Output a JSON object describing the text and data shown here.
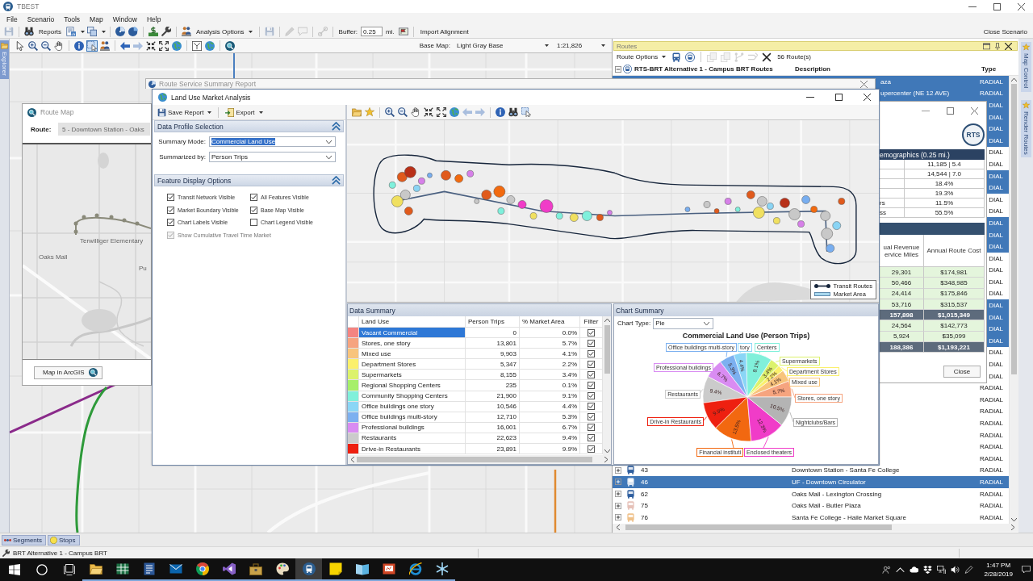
{
  "window": {
    "title": "TBEST"
  },
  "menu": [
    {
      "label": "File"
    },
    {
      "label": "Scenario"
    },
    {
      "label": "Tools"
    },
    {
      "label": "Map"
    },
    {
      "label": "Window"
    },
    {
      "label": "Help"
    }
  ],
  "toolbar": {
    "items": [
      {
        "kind": "icon",
        "disabled": true
      },
      {
        "kind": "separator"
      },
      {
        "kind": "icon",
        "disabled": false
      },
      {
        "kind": "button",
        "label": "Reports"
      },
      {
        "kind": "icon-menu",
        "disabled": false
      },
      {
        "kind": "icon-menu",
        "disabled": false
      },
      {
        "kind": "separator"
      },
      {
        "kind": "icon",
        "disabled": false
      },
      {
        "kind": "icon",
        "disabled": false
      },
      {
        "kind": "separator"
      },
      {
        "kind": "icon",
        "disabled": false
      },
      {
        "kind": "icon",
        "disabled": false
      },
      {
        "kind": "separator"
      },
      {
        "kind": "icon",
        "disabled": false
      },
      {
        "kind": "menu",
        "label": "Analysis Options"
      },
      {
        "kind": "separator"
      },
      {
        "kind": "icon",
        "disabled": true
      },
      {
        "kind": "separator"
      },
      {
        "kind": "icon",
        "disabled": true
      },
      {
        "kind": "icon",
        "disabled": true
      },
      {
        "kind": "separator"
      },
      {
        "kind": "icon",
        "disabled": true
      },
      {
        "kind": "separator"
      },
      {
        "kind": "field",
        "label": "Buffer:",
        "value": "0.25",
        "unit": "mi."
      },
      {
        "kind": "icon",
        "disabled": false
      },
      {
        "kind": "separator"
      },
      {
        "kind": "button",
        "label": "Import Alignment"
      }
    ],
    "close_label": "Close Scenario"
  },
  "explorer_tab": {
    "label": "Explorer"
  },
  "map_view": {
    "tools": [
      {
        "kind": "tool",
        "selected": false,
        "disabled": false
      },
      {
        "kind": "tool",
        "selected": false,
        "disabled": false
      },
      {
        "kind": "tool",
        "selected": false,
        "disabled": false
      },
      {
        "kind": "tool",
        "selected": false,
        "disabled": false
      },
      {
        "kind": "separator"
      },
      {
        "kind": "tool",
        "selected": false,
        "disabled": false
      },
      {
        "kind": "tool",
        "selected": true,
        "disabled": false
      },
      {
        "kind": "tool",
        "selected": false,
        "disabled": false
      },
      {
        "kind": "separator"
      },
      {
        "kind": "tool",
        "selected": false,
        "disabled": false
      },
      {
        "kind": "tool",
        "selected": false,
        "disabled": true
      },
      {
        "kind": "tool",
        "selected": false,
        "disabled": false
      },
      {
        "kind": "tool",
        "selected": false,
        "disabled": false
      },
      {
        "kind": "tool",
        "selected": false,
        "disabled": false
      },
      {
        "kind": "separator"
      },
      {
        "kind": "tool",
        "selected": false,
        "disabled": false
      },
      {
        "kind": "tool",
        "selected": false,
        "disabled": false
      },
      {
        "kind": "separator"
      },
      {
        "kind": "tool",
        "selected": false,
        "disabled": false
      }
    ],
    "base_map_label": "Base Map:",
    "base_map": "Light Gray Base",
    "scale": "1:21,826"
  },
  "routes_panel": {
    "title": "Routes",
    "options_label": "Route Options",
    "tools": [
      {
        "kind": "tool",
        "disabled": false
      },
      {
        "kind": "tool",
        "disabled": false
      },
      {
        "kind": "separator"
      },
      {
        "kind": "tool",
        "disabled": true
      },
      {
        "kind": "tool",
        "disabled": true
      },
      {
        "kind": "tool",
        "disabled": true
      },
      {
        "kind": "tool",
        "disabled": true
      },
      {
        "kind": "tool",
        "disabled": false
      }
    ],
    "route_count": "56 Route(s)",
    "group": {
      "label": "RTS-BRT Alternative 1 - Campus BRT Routes",
      "expanded": true
    },
    "columns": [
      "Description",
      "Type"
    ],
    "rows": [
      {
        "description": "aza",
        "type": "RADIAL",
        "selected": true
      },
      {
        "description": "upercenter (NE 12 AVE)",
        "type": "RADIAL",
        "selected": true
      },
      {
        "type": "DIAL",
        "selected": true
      },
      {
        "type": "DIAL",
        "selected": true
      },
      {
        "type": "DIAL",
        "selected": true
      },
      {
        "type": "DIAL",
        "selected": true
      },
      {
        "type": "DIAL",
        "selected": false
      },
      {
        "type": "DIAL",
        "selected": false
      },
      {
        "type": "DIAL",
        "selected": true
      },
      {
        "type": "DIAL",
        "selected": true
      },
      {
        "type": "DIAL",
        "selected": false
      },
      {
        "type": "DIAL",
        "selected": false
      },
      {
        "type": "DIAL",
        "selected": true
      },
      {
        "type": "DIAL",
        "selected": true
      },
      {
        "type": "DIAL",
        "selected": true
      },
      {
        "type": "DIAL",
        "selected": false
      },
      {
        "type": "DIAL",
        "selected": false
      },
      {
        "type": "DIAL",
        "selected": false
      },
      {
        "type": "DIAL",
        "selected": false
      },
      {
        "type": "DIAL",
        "selected": true
      },
      {
        "type": "DIAL",
        "selected": true
      },
      {
        "type": "DIAL",
        "selected": true
      },
      {
        "type": "DIAL",
        "selected": true
      },
      {
        "type": "DIAL",
        "selected": false
      },
      {
        "type": "DIAL",
        "selected": false
      },
      {
        "type": "DIAL",
        "selected": false
      },
      {
        "type": "RADIAL",
        "selected": false
      },
      {
        "type": "RADIAL",
        "selected": false
      },
      {
        "type": "RADIAL",
        "selected": false
      },
      {
        "type": "RADIAL",
        "selected": false
      },
      {
        "type": "RADIAL",
        "selected": false
      },
      {
        "type": "RADIAL",
        "selected": false
      },
      {
        "type": "RADIAL",
        "selected": false
      },
      {
        "expanded": false,
        "color": "#2f5f9f",
        "number": "43",
        "description": "Downtown Station - Santa Fe College",
        "type": "RADIAL",
        "selected": false
      },
      {
        "expanded": false,
        "color": "#dde7f3",
        "number": "46",
        "description": "UF - Downtown Circulator",
        "type": "RADIAL",
        "selected": true
      },
      {
        "expanded": false,
        "color": "#2f5f9f",
        "number": "62",
        "description": "Oaks Mall - Lexington Crossing",
        "type": "RADIAL",
        "selected": false
      },
      {
        "expanded": false,
        "color": "#e6c1b8",
        "number": "75",
        "description": "Oaks Mall - Butler Plaza",
        "type": "RADIAL",
        "selected": false
      },
      {
        "expanded": false,
        "color": "#efc189",
        "number": "76",
        "description": "Santa Fe College - Haile Market Square",
        "type": "RADIAL",
        "selected": false
      }
    ]
  },
  "side_tabs": [
    {
      "label": "Map Control"
    },
    {
      "label": "Render Routes"
    }
  ],
  "route_map_window": {
    "title": "Route Map",
    "route_label": "Route:",
    "route_value": "5 - Downtown Station - Oaks",
    "map_labels": [
      "Oaks Mall",
      "Terwilliger Elementary",
      "Pu"
    ],
    "button": "Map in ArcGIS"
  },
  "summary_report_window": {
    "title": "Route Service Summary Report"
  },
  "report_panel": {
    "logo": "RTS",
    "demographics_title": "emographics (0.25 mi.)",
    "demographics": [
      {
        "value": "11,185 | 5.4"
      },
      {
        "value": "14,544 | 7.0"
      },
      {
        "value": "18.4%"
      },
      {
        "value": "19.3%"
      },
      {
        "label": "rs",
        "value": "11.5%"
      },
      {
        "label": "ss",
        "value": "55.5%"
      }
    ],
    "cost_columns": [
      "ual Revenue\nervice Miles",
      "Annual Route Cost"
    ],
    "cost_rows": [
      {
        "kind": "route",
        "miles": "29,301",
        "cost": "$174,981"
      },
      {
        "kind": "route",
        "miles": "50,466",
        "cost": "$348,985"
      },
      {
        "kind": "route",
        "miles": "24,414",
        "cost": "$175,846"
      },
      {
        "kind": "route",
        "miles": "53,716",
        "cost": "$315,537"
      },
      {
        "kind": "total",
        "miles": "157,898",
        "cost": "$1,015,349"
      },
      {
        "kind": "route",
        "miles": "24,564",
        "cost": "$142,773"
      },
      {
        "kind": "route",
        "miles": "5,924",
        "cost": "$35,099"
      },
      {
        "kind": "total",
        "miles": "188,386",
        "cost": "$1,193,221"
      }
    ],
    "close_label": "Close"
  },
  "land_use_window": {
    "title": "Land Use Market Analysis",
    "toolbar": [
      {
        "label": "Save Report"
      },
      {
        "label": "Export"
      }
    ],
    "data_profile": {
      "title": "Data Profile Selection",
      "expanded": true,
      "fields": [
        {
          "label": "Summary Mode:",
          "value": "Commercial Land Use",
          "selected": true
        },
        {
          "label": "Summarized by:",
          "value": "Person Trips",
          "selected": false
        }
      ]
    },
    "display_options": {
      "title": "Feature Display Options",
      "expanded": true,
      "options": [
        {
          "label": "Transit Network Visible",
          "checked": true
        },
        {
          "label": "All Features Visible",
          "checked": true
        },
        {
          "label": "Market Boundary Visible",
          "checked": true
        },
        {
          "label": "Base Map Visible",
          "checked": true
        },
        {
          "label": "Chart Labels Visible",
          "checked": true
        },
        {
          "label": "Chart Legend Visible",
          "checked": false
        }
      ],
      "cumulative": {
        "label": "Show Cumulative Travel Time Market",
        "checked": true,
        "disabled": true
      }
    },
    "map_tools": [
      {
        "kind": "tool",
        "disabled": false
      },
      {
        "kind": "tool",
        "disabled": false
      },
      {
        "kind": "separator"
      },
      {
        "kind": "tool",
        "disabled": false
      },
      {
        "kind": "tool",
        "disabled": false
      },
      {
        "kind": "tool",
        "disabled": false
      },
      {
        "kind": "tool",
        "disabled": false
      },
      {
        "kind": "tool",
        "disabled": false
      },
      {
        "kind": "tool",
        "disabled": false
      },
      {
        "kind": "tool",
        "disabled": true
      },
      {
        "kind": "tool",
        "disabled": true
      },
      {
        "kind": "separator"
      },
      {
        "kind": "tool",
        "disabled": false
      },
      {
        "kind": "tool",
        "disabled": false
      },
      {
        "kind": "tool",
        "disabled": false
      }
    ],
    "legend": [
      {
        "label": "Transit Routes",
        "kind": "line"
      },
      {
        "label": "Market Area",
        "kind": "area"
      }
    ],
    "data_summary": {
      "title": "Data Summary",
      "columns": [
        "Land Use",
        "Person Trips",
        "% Market Area",
        "Filter"
      ],
      "rows": [
        {
          "color": "#f48481",
          "land_use": "Vacant Commercial",
          "trips": "0",
          "share": "0.0%",
          "filter": true,
          "selected": true
        },
        {
          "color": "#f6a47f",
          "land_use": "Stores, one story",
          "trips": "13,801",
          "share": "5.7%",
          "filter": true,
          "selected": false
        },
        {
          "color": "#f8c47c",
          "land_use": "Mixed use",
          "trips": "9,903",
          "share": "4.1%",
          "filter": true,
          "selected": false
        },
        {
          "color": "#fbf06c",
          "land_use": "Department Stores",
          "trips": "5,347",
          "share": "2.2%",
          "filter": true,
          "selected": false
        },
        {
          "color": "#dcf26c",
          "land_use": "Supermarkets",
          "trips": "8,155",
          "share": "3.4%",
          "filter": true,
          "selected": false
        },
        {
          "color": "#a6ef6a",
          "land_use": "Regional Shopping Centers",
          "trips": "235",
          "share": "0.1%",
          "filter": true,
          "selected": false
        },
        {
          "color": "#80f0da",
          "land_use": "Community Shopping Centers",
          "trips": "21,900",
          "share": "9.1%",
          "filter": true,
          "selected": false
        },
        {
          "color": "#8ad6f6",
          "land_use": "Office buildings one story",
          "trips": "10,546",
          "share": "4.4%",
          "filter": true,
          "selected": false
        },
        {
          "color": "#7cb0f0",
          "land_use": "Office buildings multi-story",
          "trips": "12,710",
          "share": "5.3%",
          "filter": true,
          "selected": false
        },
        {
          "color": "#d98cf2",
          "land_use": "Professional buildings",
          "trips": "16,001",
          "share": "6.7%",
          "filter": true,
          "selected": false
        },
        {
          "color": "#cbcbcb",
          "land_use": "Restaurants",
          "trips": "22,623",
          "share": "9.4%",
          "filter": true,
          "selected": false
        },
        {
          "color": "#ee2010",
          "land_use": "Drive-in Restaurants",
          "trips": "23,891",
          "share": "9.9%",
          "filter": true,
          "selected": false
        }
      ]
    },
    "chart_summary": {
      "title": "Chart Summary",
      "chart_type_label": "Chart Type:",
      "chart_type": "Pie",
      "chart_data": {
        "type": "pie",
        "title": "Commercial Land Use (Person Trips)",
        "categories": [
          "Stores, one story",
          "Mixed use",
          "Department Stores",
          "Supermarkets",
          "Centers",
          "tory",
          "Office buildings multi-story",
          "Professional buildings",
          "Restaurants",
          "Drive-in Restaurants",
          "Financial instituti",
          "Enclosed theaters",
          "Nightclubs/Bars"
        ],
        "values": [
          5.7,
          4.1,
          2.2,
          3.4,
          9.1,
          4.4,
          5.3,
          6.7,
          9.4,
          9.9,
          13.5,
          12.3,
          10.5
        ],
        "value_labels": [
          "5.7%",
          "4.1%",
          "2.2%",
          "3.4%",
          "9.1%",
          "4.4%",
          "5.3%",
          "6.7%",
          "9.4%",
          "9.9%",
          "13.5%",
          "12.3%",
          "10.5%"
        ],
        "colors": [
          "#f6a47f",
          "#f8c47c",
          "#fbf06c",
          "#dcf26c",
          "#80f0da",
          "#8ad6f6",
          "#7cb0f0",
          "#d98cf2",
          "#cbcbcb",
          "#ee2010",
          "#f26810",
          "#f03cc8",
          "#b4b4b4"
        ]
      }
    }
  },
  "bottom_tabs": [
    {
      "label": "Segments",
      "selected": false
    },
    {
      "label": "Stops",
      "selected": false
    }
  ],
  "status_bar": {
    "text": "BRT Alternative 1 - Campus BRT"
  },
  "taskbar": {
    "apps": [
      {
        "open": true,
        "selected": false
      },
      {
        "open": true,
        "selected": false
      },
      {
        "open": true,
        "selected": false
      },
      {
        "open": true,
        "selected": false
      },
      {
        "open": true,
        "selected": false
      },
      {
        "open": true,
        "selected": false
      },
      {
        "open": true,
        "selected": false
      },
      {
        "open": true,
        "selected": false
      },
      {
        "open": true,
        "selected": true
      },
      {
        "open": true,
        "selected": false
      },
      {
        "open": true,
        "selected": false
      },
      {
        "open": true,
        "selected": false
      },
      {
        "open": true,
        "selected": false
      },
      {
        "open": true,
        "selected": false
      }
    ],
    "time": "1:47 PM",
    "date": "2/28/2019"
  }
}
